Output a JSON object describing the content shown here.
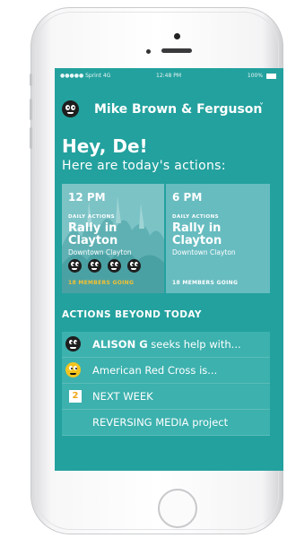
{
  "status_bar": {
    "carrier": "●●●●● Sprint 4G",
    "time": "12:48 PM",
    "battery": "100%"
  },
  "header": {
    "group_name": "Mike Brown & Ferguson",
    "chevron": "˅"
  },
  "greeting": {
    "title": "Hey, De!",
    "subtitle": "Here are today's actions:"
  },
  "today_actions": [
    {
      "time": "12 PM",
      "category": "DAILY ACTIONS",
      "title": "Rally in Clayton",
      "location": "Downtown Clayton",
      "going": "18 MEMBERS GOING",
      "going_color": "#f4c132",
      "member_avatars": 4
    },
    {
      "time": "6 PM",
      "category": "DAILY ACTIONS",
      "title": "Rally in Clayton",
      "location": "Downtown Clayton",
      "going": "18 MEMBERS GOING",
      "going_color": "#ffffff"
    }
  ],
  "beyond_today": {
    "heading": "ACTIONS BEYOND TODAY",
    "items": [
      {
        "icon": "avatar-black",
        "bold": "ALISON G",
        "text": " seeks help with..."
      },
      {
        "icon": "avatar-yellow",
        "bold": "",
        "text": "American Red Cross is..."
      },
      {
        "icon": "date-badge",
        "badge": "2",
        "bold": "",
        "text": "NEXT WEEK"
      },
      {
        "icon": "",
        "bold": "",
        "text": "REVERSING MEDIA project"
      }
    ]
  },
  "colors": {
    "screen_bg": "#23a19e",
    "accent_yellow": "#f4c132",
    "badge_orange": "#f0a51a"
  }
}
